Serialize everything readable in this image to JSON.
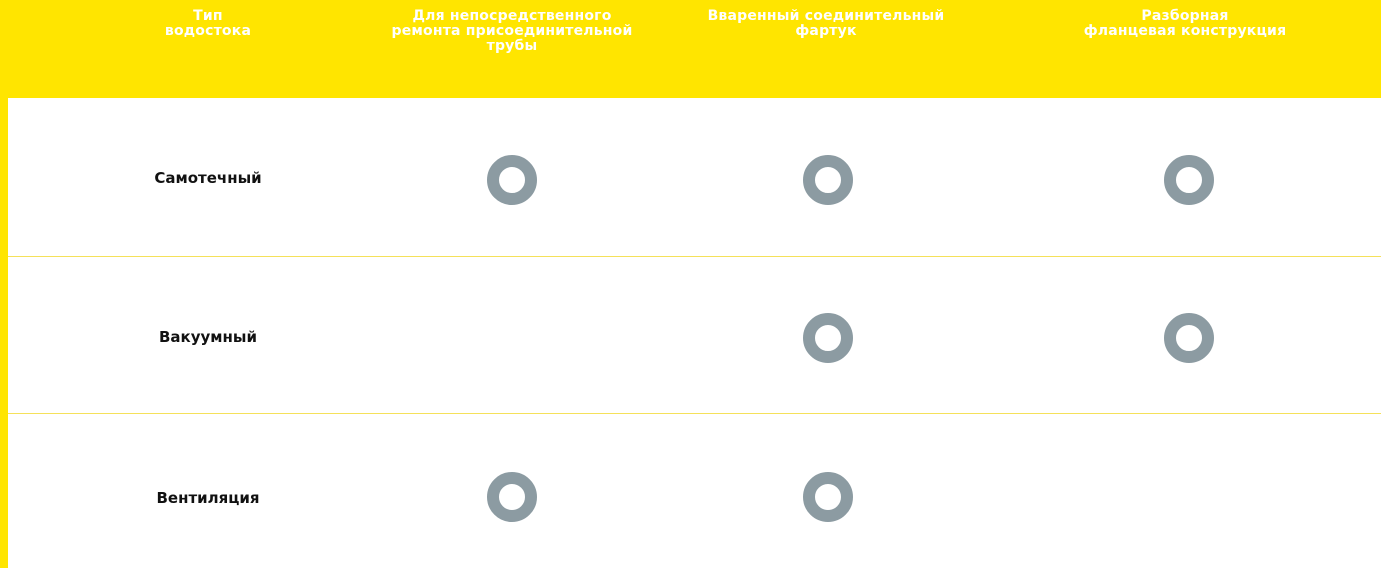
{
  "colors": {
    "header_bg": "#ffe500",
    "header_text": "#ffffff",
    "row_divider": "#f5e15a",
    "mark": "#8c9ba2"
  },
  "header": {
    "col0": [
      "Тип",
      "водостока"
    ],
    "col1": [
      "Для непосредственного",
      "ремонта присоединительной",
      "трубы"
    ],
    "col2": [
      "Вваренный соединительный",
      "фартук"
    ],
    "col3": [
      "Разборная",
      "фланцевая конструкция"
    ]
  },
  "rows": [
    {
      "label": "Самотечный",
      "marks": [
        "ring-icon",
        "ring-icon",
        "ring-icon"
      ]
    },
    {
      "label": "Вакуумный",
      "marks": [
        "",
        "ring-icon",
        "ring-icon"
      ]
    },
    {
      "label": "Вентиляция",
      "marks": [
        "ring-icon",
        "ring-icon",
        ""
      ]
    }
  ]
}
